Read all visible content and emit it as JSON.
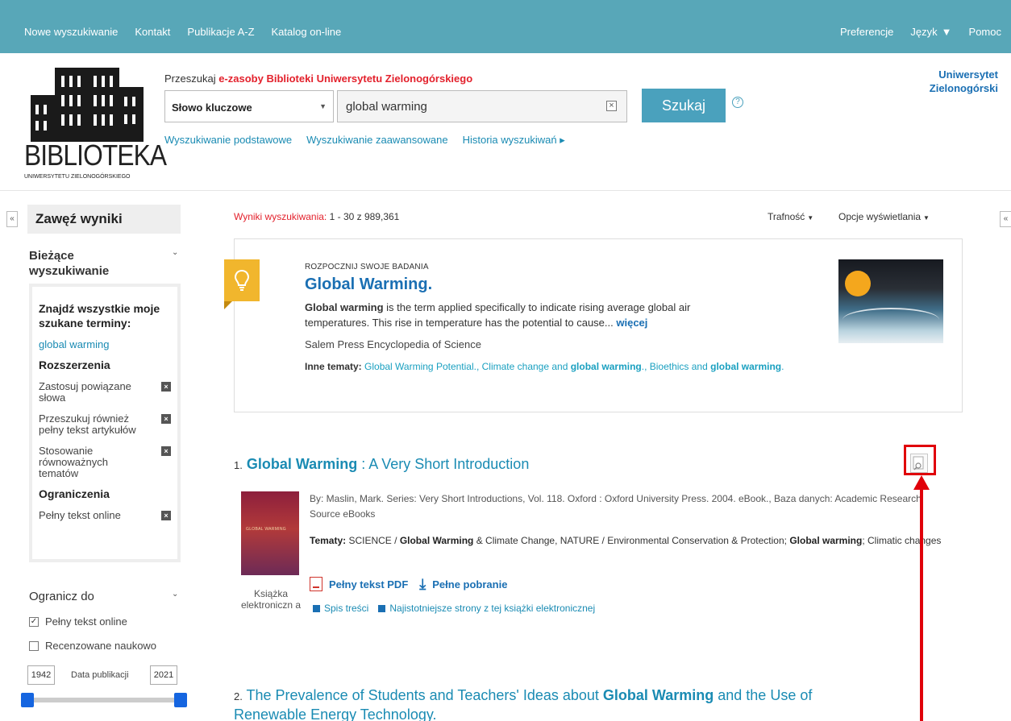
{
  "nav": {
    "left": [
      "Nowe wyszukiwanie",
      "Kontakt",
      "Publikacje A-Z",
      "Katalog on-line"
    ],
    "preferences": "Preferencje",
    "language": "Język",
    "help": "Pomoc"
  },
  "header": {
    "logo_text": "BIBLIOTEKA",
    "logo_subtext": "UNIWERSYTETU ZIELONOGÓRSKIEGO",
    "search_prefix": "Przeszukaj",
    "search_target": "e-zasoby Biblioteki Uniwersytetu Zielonogórskiego",
    "field_value": "Słowo kluczowe",
    "query": "global warming",
    "search_button": "Szukaj",
    "links": [
      "Wyszukiwanie podstawowe",
      "Wyszukiwanie zaawansowane",
      "Historia wyszukiwań ▸"
    ],
    "university_line1": "Uniwersytet",
    "university_line2": "Zielonogórski"
  },
  "sidebar": {
    "title": "Zawęź wyniki",
    "current_search_title": "Bieżące wyszukiwanie",
    "find_all_heading": "Znajdź wszystkie moje szukane terminy:",
    "term": "global warming",
    "expanders_title": "Rozszerzenia",
    "expanders": [
      "Zastosuj powiązane słowa",
      "Przeszukuj również pełny tekst artykułów",
      "Stosowanie równoważnych tematów"
    ],
    "limiters_title": "Ograniczenia",
    "limiters": [
      "Pełny tekst online"
    ],
    "limit_to_title": "Ogranicz do",
    "limit_options": [
      {
        "label": "Pełny tekst online",
        "checked": true
      },
      {
        "label": "Recenzowane naukowo",
        "checked": false
      }
    ],
    "year_from": "1942",
    "year_to": "2021",
    "date_label": "Data publikacji"
  },
  "results": {
    "count_label": "Wyniki wyszukiwania:",
    "count_value": "1 - 30 z 989,361",
    "sort": "Trafność",
    "display_options": "Opcje wyświetlania"
  },
  "starter": {
    "kicker": "ROZPOCZNIJ SWOJE BADANIA",
    "title": "Global Warming.",
    "desc_bold": "Global warming",
    "desc_rest": " is the term applied specifically to indicate rising average global air temperatures. This rise in temperature has the potential to cause... ",
    "more": "więcej",
    "source": "Salem Press Encyclopedia of Science",
    "topics_label": "Inne tematy:",
    "topics_text_1": " Global Warming Potential., Climate change and ",
    "topics_bold": "global warming",
    "topics_text_2": "., Bioethics and ",
    "topics_bold_2": "global warming",
    "topics_text_3": "."
  },
  "result1": {
    "number": "1.",
    "title_bold": "Global Warming",
    "title_rest": " : A Very Short Introduction",
    "cover_text": "GLOBAL WARMING",
    "type_label": "Książka elektroniczn a",
    "meta": "By: Maslin, Mark. Series: Very Short Introductions, Vol. 118. Oxford : Oxford University Press. 2004. eBook., Baza danych: Academic Research Source eBooks",
    "topics_label": "Tematy:",
    "topics_a": " SCIENCE / ",
    "topics_b": "Global Warming",
    "topics_c": " & Climate Change, NATURE / Environmental Conservation & Protection; ",
    "topics_d": "Global warming",
    "topics_e": "; Climatic changes",
    "pdf_link": "Pełny tekst PDF",
    "download_link": "Pełne pobranie",
    "toc_link": "Spis treści",
    "relevant_link": "Najistotniejsze strony z tej książki elektronicznej"
  },
  "result2": {
    "number": "2.",
    "title_a": " The Prevalence of Students and Teachers' Ideas about ",
    "title_bold": "Global Warming",
    "title_b": " and the Use of Renewable Energy Technology."
  },
  "colors": {
    "navbar": "#58a7b8",
    "accent": "#e3212c",
    "link": "#1a8bb3",
    "highlight": "#e0000a"
  }
}
